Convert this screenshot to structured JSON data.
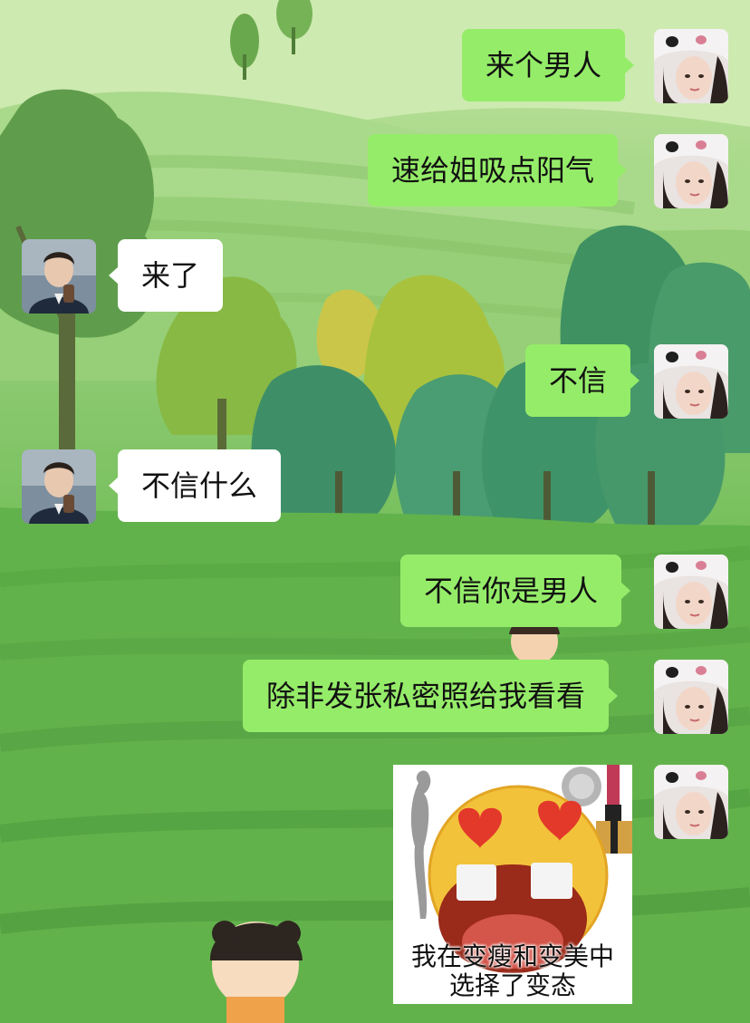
{
  "messages": [
    {
      "sender": "self",
      "text": "来个男人"
    },
    {
      "sender": "self",
      "text": "速给姐吸点阳气"
    },
    {
      "sender": "other",
      "text": "来了"
    },
    {
      "sender": "self",
      "text": "不信"
    },
    {
      "sender": "other",
      "text": "不信什么"
    },
    {
      "sender": "self",
      "text": "不信你是男人"
    },
    {
      "sender": "self",
      "text": "除非发张私密照给我看看"
    }
  ],
  "sticker": {
    "caption_line1": "我在变瘦和变美中",
    "caption_line2": "选择了变态"
  },
  "colors": {
    "outgoing_bubble": "#95ec69",
    "incoming_bubble": "#ffffff"
  },
  "icons": {
    "self_avatar": "self-avatar-icon",
    "contact_avatar": "contact-avatar-icon"
  }
}
